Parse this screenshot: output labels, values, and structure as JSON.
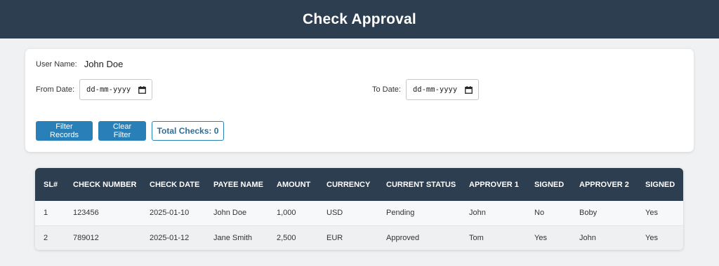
{
  "header": {
    "title": "Check Approval"
  },
  "filters": {
    "user_label": "User Name:",
    "user_value": "John Doe",
    "from_label": "From Date:",
    "from_placeholder": "dd-mm-yyyy",
    "to_label": "To Date:",
    "to_placeholder": "dd-mm-yyyy",
    "filter_button": "Filter Records",
    "clear_button": "Clear Filter",
    "total_label": "Total Checks: 0"
  },
  "table": {
    "headers": {
      "sl": "SL#",
      "check_number": "CHECK NUMBER",
      "check_date": "CHECK DATE",
      "payee_name": "PAYEE NAME",
      "amount": "AMOUNT",
      "currency": "CURRENCY",
      "current_status": "CURRENT STATUS",
      "approver1": "APPROVER 1",
      "signed1": "SIGNED",
      "approver2": "APPROVER 2",
      "signed2": "SIGNED"
    },
    "rows": [
      {
        "sl": "1",
        "check_number": "123456",
        "check_date": "2025-01-10",
        "payee_name": "John Doe",
        "amount": "1,000",
        "currency": "USD",
        "current_status": "Pending",
        "approver1": "John",
        "signed1": "No",
        "approver2": "Boby",
        "signed2": "Yes"
      },
      {
        "sl": "2",
        "check_number": "789012",
        "check_date": "2025-01-12",
        "payee_name": "Jane Smith",
        "amount": "2,500",
        "currency": "EUR",
        "current_status": "Approved",
        "approver1": "Tom",
        "signed1": "Yes",
        "approver2": "John",
        "signed2": "Yes"
      }
    ]
  },
  "colors": {
    "header_bg": "#2c3e50",
    "accent": "#2980b9",
    "page_bg": "#f0f1f3"
  },
  "icons": {
    "date_picker": "calendar-icon"
  }
}
